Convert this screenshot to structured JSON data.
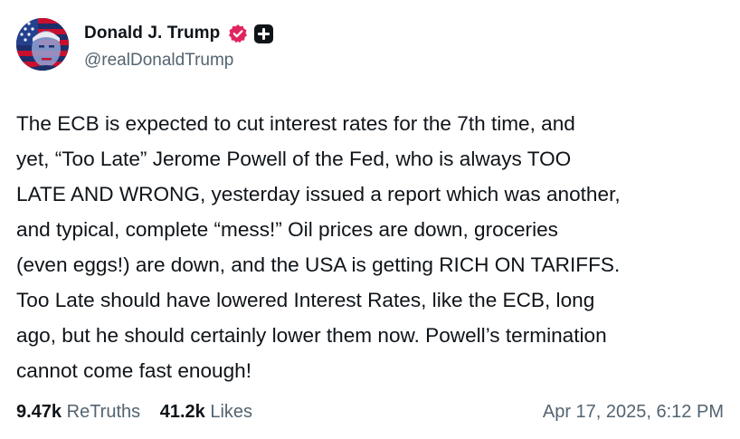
{
  "author": {
    "display_name": "Donald J. Trump",
    "handle": "@realDonaldTrump",
    "avatar_icon": "flag-portrait-avatar",
    "verified_badge_icon": "verified-badge-icon",
    "verified_color": "#e0245e",
    "plus_badge_icon": "plus-badge-icon"
  },
  "post": {
    "lines": [
      "The ECB is expected to cut interest rates for the 7th time, and",
      "yet, “Too Late” Jerome Powell of the Fed, who is always TOO",
      "LATE AND WRONG, yesterday issued a report which was another,",
      "and typical, complete “mess!” Oil prices are down, groceries",
      "(even eggs!) are down, and the USA is getting RICH ON TARIFFS.",
      "Too Late should have lowered Interest Rates, like the ECB, long",
      "ago, but he should certainly lower them now. Powell’s termination",
      "cannot come fast enough!"
    ]
  },
  "stats": {
    "retruths_count": "9.47k",
    "retruths_label": "ReTruths",
    "likes_count": "41.2k",
    "likes_label": "Likes"
  },
  "timestamp": "Apr 17, 2025, 6:12 PM"
}
